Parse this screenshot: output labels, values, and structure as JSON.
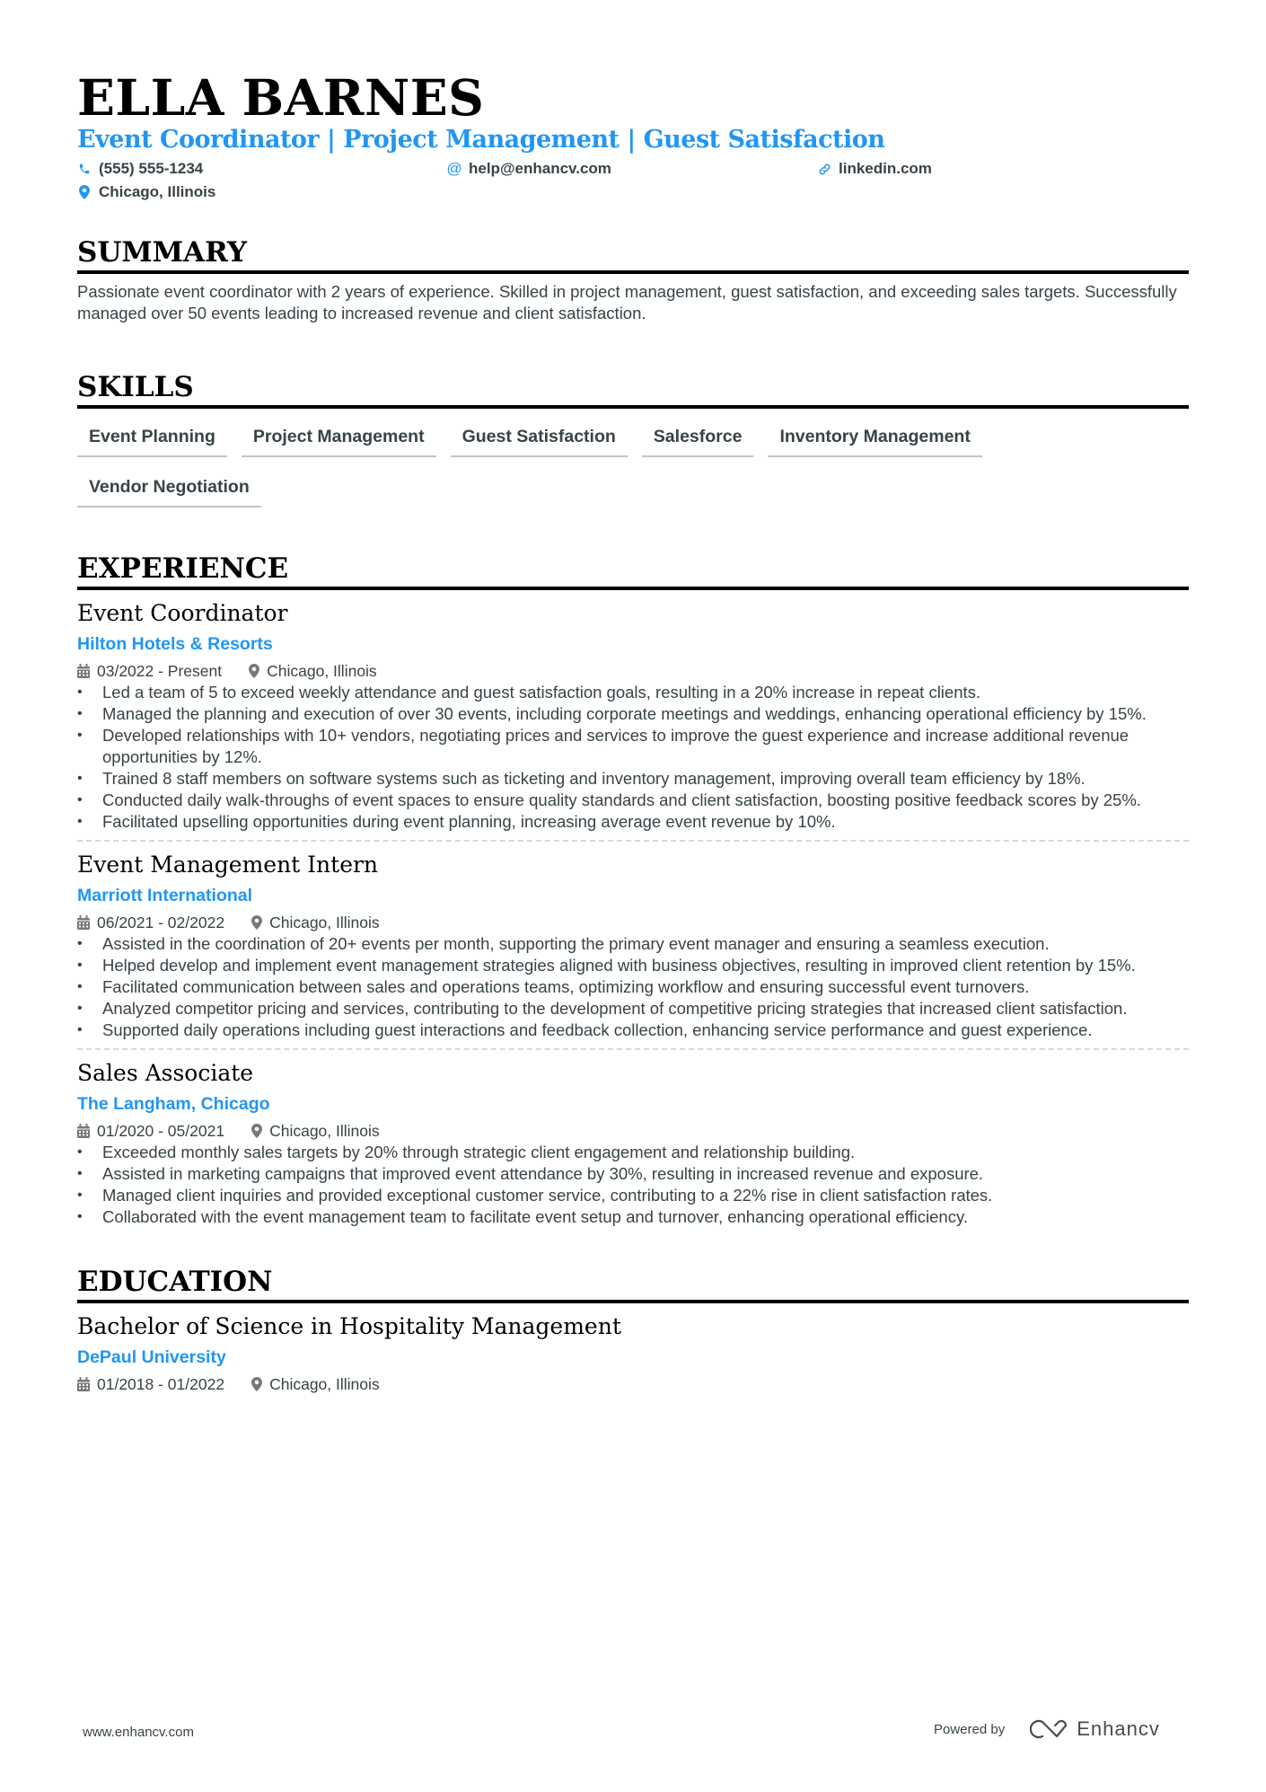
{
  "header": {
    "name": "ELLA BARNES",
    "headline": "Event Coordinator | Project Management | Guest Satisfaction",
    "contacts": {
      "phone": "(555) 555-1234",
      "email": "help@enhancv.com",
      "link": "linkedin.com",
      "location": "Chicago, Illinois"
    },
    "accent_color": "#2196f3"
  },
  "summary": {
    "title": "SUMMARY",
    "text": "Passionate event coordinator with 2 years of experience. Skilled in project management, guest satisfaction, and exceeding sales targets. Successfully managed over 50 events leading to increased revenue and client satisfaction."
  },
  "skills": {
    "title": "SKILLS",
    "items": [
      "Event Planning",
      "Project Management",
      "Guest Satisfaction",
      "Salesforce",
      "Inventory Management",
      "Vendor Negotiation"
    ]
  },
  "experience": {
    "title": "EXPERIENCE",
    "items": [
      {
        "title": "Event Coordinator",
        "company": "Hilton Hotels & Resorts",
        "dates": "03/2022 - Present",
        "location": "Chicago, Illinois",
        "bullets": [
          "Led a team of 5 to exceed weekly attendance and guest satisfaction goals, resulting in a 20% increase in repeat clients.",
          "Managed the planning and execution of over 30 events, including corporate meetings and weddings, enhancing operational efficiency by 15%.",
          "Developed relationships with 10+ vendors, negotiating prices and services to improve the guest experience and increase additional revenue opportunities by 12%.",
          "Trained 8 staff members on software systems such as ticketing and inventory management, improving overall team efficiency by 18%.",
          "Conducted daily walk-throughs of event spaces to ensure quality standards and client satisfaction, boosting positive feedback scores by 25%.",
          "Facilitated upselling opportunities during event planning, increasing average event revenue by 10%."
        ]
      },
      {
        "title": "Event Management Intern",
        "company": "Marriott International",
        "dates": "06/2021 - 02/2022",
        "location": "Chicago, Illinois",
        "bullets": [
          "Assisted in the coordination of 20+ events per month, supporting the primary event manager and ensuring a seamless execution.",
          "Helped develop and implement event management strategies aligned with business objectives, resulting in improved client retention by 15%.",
          "Facilitated communication between sales and operations teams, optimizing workflow and ensuring successful event turnovers.",
          "Analyzed competitor pricing and services, contributing to the development of competitive pricing strategies that increased client satisfaction.",
          "Supported daily operations including guest interactions and feedback collection, enhancing service performance and guest experience."
        ]
      },
      {
        "title": "Sales Associate",
        "company": "The Langham, Chicago",
        "dates": "01/2020 - 05/2021",
        "location": "Chicago, Illinois",
        "bullets": [
          "Exceeded monthly sales targets by 20% through strategic client engagement and relationship building.",
          "Assisted in marketing campaigns that improved event attendance by 30%, resulting in increased revenue and exposure.",
          "Managed client inquiries and provided exceptional customer service, contributing to a 22% rise in client satisfaction rates.",
          "Collaborated with the event management team to facilitate event setup and turnover, enhancing operational efficiency."
        ]
      }
    ]
  },
  "education": {
    "title": "EDUCATION",
    "items": [
      {
        "degree": "Bachelor of Science in Hospitality Management",
        "school": "DePaul University",
        "dates": "01/2018 - 01/2022",
        "location": "Chicago, Illinois"
      }
    ]
  },
  "footer": {
    "website": "www.enhancv.com",
    "powered_by": "Powered by",
    "brand": "Enhancv"
  },
  "icons": {
    "phone": "phone-icon",
    "email": "at-icon",
    "link": "link-icon",
    "location": "map-pin-icon",
    "date": "calendar-icon"
  }
}
